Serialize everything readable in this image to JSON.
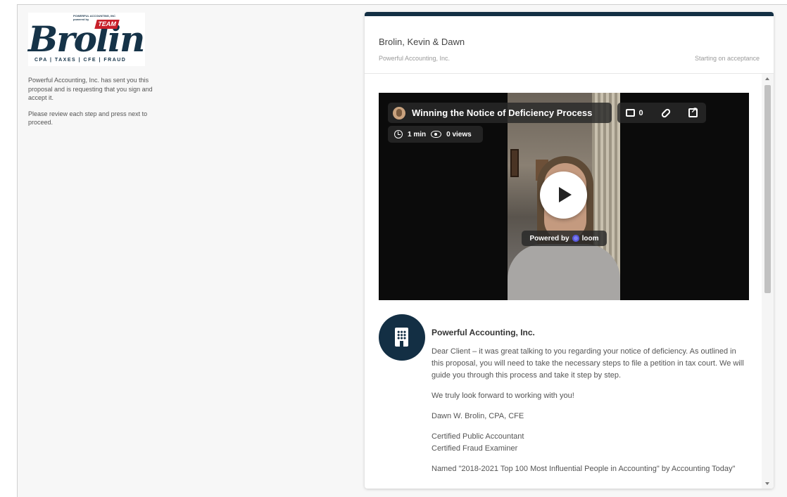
{
  "logo": {
    "small_text": "POWERFUL ACCOUNTING, INC",
    "small_text2": "powered by",
    "team": "TEAM",
    "brand": "Brolin",
    "tagline": "CPA | TAXES | CFE | FRAUD"
  },
  "intro": {
    "line1": "Powerful Accounting, Inc. has sent you this proposal and is requesting that you sign and accept it.",
    "line2": "Please review each step and press next to proceed."
  },
  "proposal": {
    "client_name": "Brolin, Kevin & Dawn",
    "firm_name": "Powerful Accounting, Inc.",
    "start_label": "Starting on acceptance"
  },
  "video": {
    "title": "Winning the Notice of Deficiency Process",
    "comment_count": "0",
    "duration": "1 min",
    "views": "0 views",
    "powered_by": "Powered by",
    "powered_brand": "loom"
  },
  "message": {
    "from": "Powerful Accounting, Inc.",
    "p1": "Dear Client – it was great talking to you regarding your notice of deficiency. As outlined in this proposal, you will need to take the necessary steps to file a petition in tax court. We will guide you through this process and take it step by step.",
    "p2": "We truly look forward to working with you!",
    "p3": "Dawn W. Brolin, CPA, CFE",
    "p4a": "Certified Public Accountant",
    "p4b": "Certified Fraud Examiner",
    "p5": "Named \"2018-2021 Top 100 Most Influential People in Accounting\" by Accounting Today\""
  },
  "colors": {
    "navy": "#132f44",
    "brand_red": "#c8202a"
  }
}
